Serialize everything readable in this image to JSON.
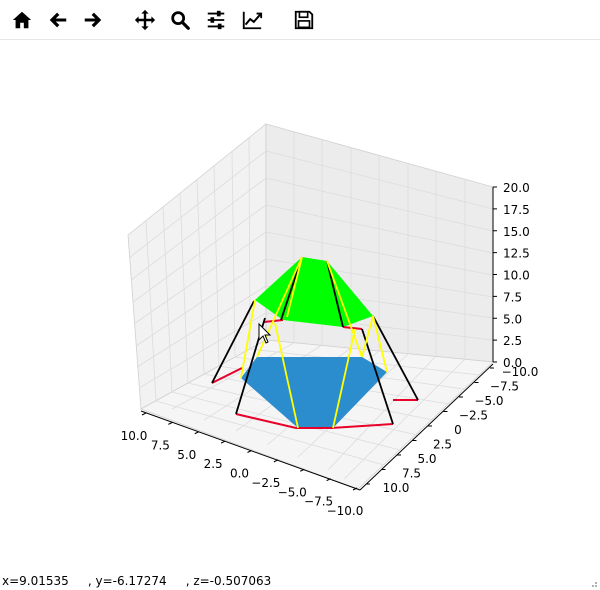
{
  "toolbar": {
    "buttons": [
      {
        "name": "home",
        "icon": "home-icon"
      },
      {
        "name": "back",
        "icon": "arrow-left-icon"
      },
      {
        "name": "forward",
        "icon": "arrow-right-icon"
      },
      {
        "name": "pan",
        "icon": "move-icon"
      },
      {
        "name": "zoom",
        "icon": "magnifier-icon"
      },
      {
        "name": "configure-subplots",
        "icon": "sliders-icon"
      },
      {
        "name": "edit-axis",
        "icon": "line-chart-icon"
      },
      {
        "name": "save",
        "icon": "floppy-disk-icon"
      }
    ]
  },
  "status": {
    "x": "x=9.01535",
    "y": ", y=-6.17274",
    "z": ", z=-0.507063"
  },
  "chart_data": {
    "type": "3d-surface",
    "title": "",
    "axes": {
      "x_ticks": [
        "10.0",
        "7.5",
        "5.0",
        "2.5",
        "0.0",
        "−2.5",
        "−5.0",
        "−7.5",
        "−10.0"
      ],
      "y_ticks": [
        "−10.0",
        "−7.5",
        "−5.0",
        "−2.5",
        "0",
        "2.5",
        "5.0",
        "7.5",
        "10.0"
      ],
      "z_ticks": [
        "0.0",
        "2.5",
        "5.0",
        "7.5",
        "10.0",
        "12.5",
        "15.0",
        "17.5",
        "20.0"
      ],
      "xlim": [
        -10,
        10
      ],
      "ylim": [
        -10,
        10
      ],
      "zlim": [
        0,
        20
      ],
      "grid": true
    },
    "shapes": [
      {
        "name": "bottom-hexagon",
        "z": 0,
        "color": "#2b8cce"
      },
      {
        "name": "top-hexagon",
        "z": 10,
        "color": "#00ff00"
      },
      {
        "name": "lower-outer-ring",
        "color": "#e8002b"
      },
      {
        "name": "upper-outer-ring",
        "color": "#e8002b"
      },
      {
        "name": "black-struts",
        "color": "#000000"
      },
      {
        "name": "yellow-struts",
        "color": "#ffff00"
      }
    ]
  }
}
